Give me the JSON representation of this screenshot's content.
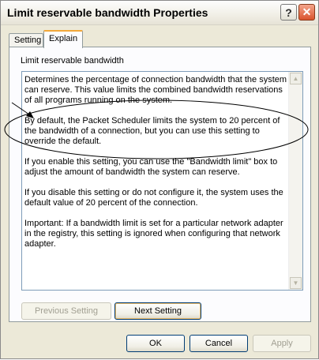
{
  "window": {
    "title": "Limit reservable bandwidth Properties"
  },
  "titlebar_buttons": {
    "help": "?",
    "close": "✕"
  },
  "tabs": [
    {
      "label": "Setting",
      "active": false
    },
    {
      "label": "Explain",
      "active": true
    }
  ],
  "panel": {
    "heading": "Limit reservable bandwidth",
    "paragraphs": [
      "Determines the percentage of connection bandwidth that the system can reserve. This value limits the combined bandwidth reservations of all programs running on the system.",
      "By default, the Packet Scheduler limits the system to 20 percent of the bandwidth of a connection, but you can use this setting to override the default.",
      "If you enable this setting, you can use the \"Bandwidth limit\" box to adjust the amount of bandwidth the system can reserve.",
      "If you disable this setting or do not configure it, the system uses the default value of 20 percent of the connection.",
      "Important: If a bandwidth limit is set for a particular network adapter in the registry, this setting is ignored when configuring that network adapter."
    ]
  },
  "buttons": {
    "previous": "Previous Setting",
    "next": "Next Setting",
    "ok": "OK",
    "cancel": "Cancel",
    "apply": "Apply"
  },
  "icons": {
    "scroll_up": "▲",
    "scroll_down": "▼"
  },
  "colors": {
    "close_button": "#d9532c",
    "annotation": "#000000",
    "focus_accent": "#f3a83a"
  }
}
